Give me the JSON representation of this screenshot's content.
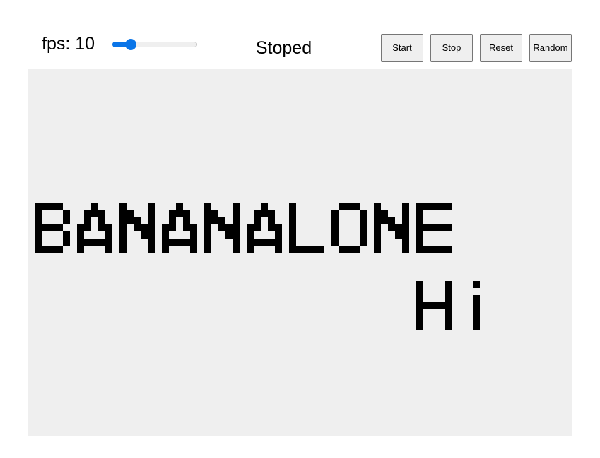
{
  "controls": {
    "fps_label": "fps:",
    "fps_value": "10",
    "fps_slider_fraction": 0.18,
    "status": "Stoped",
    "buttons": {
      "start": "Start",
      "stop": "Stop",
      "reset": "Reset",
      "random": "Random"
    }
  },
  "board": {
    "background": "#efefef",
    "cell_color": "#000000",
    "patterns": [
      {
        "text": "BANANALONE"
      },
      {
        "text": "Hi"
      }
    ]
  },
  "colors": {
    "accent": "#0a75e8",
    "button_bg": "#efefef",
    "button_border": "#767676"
  }
}
